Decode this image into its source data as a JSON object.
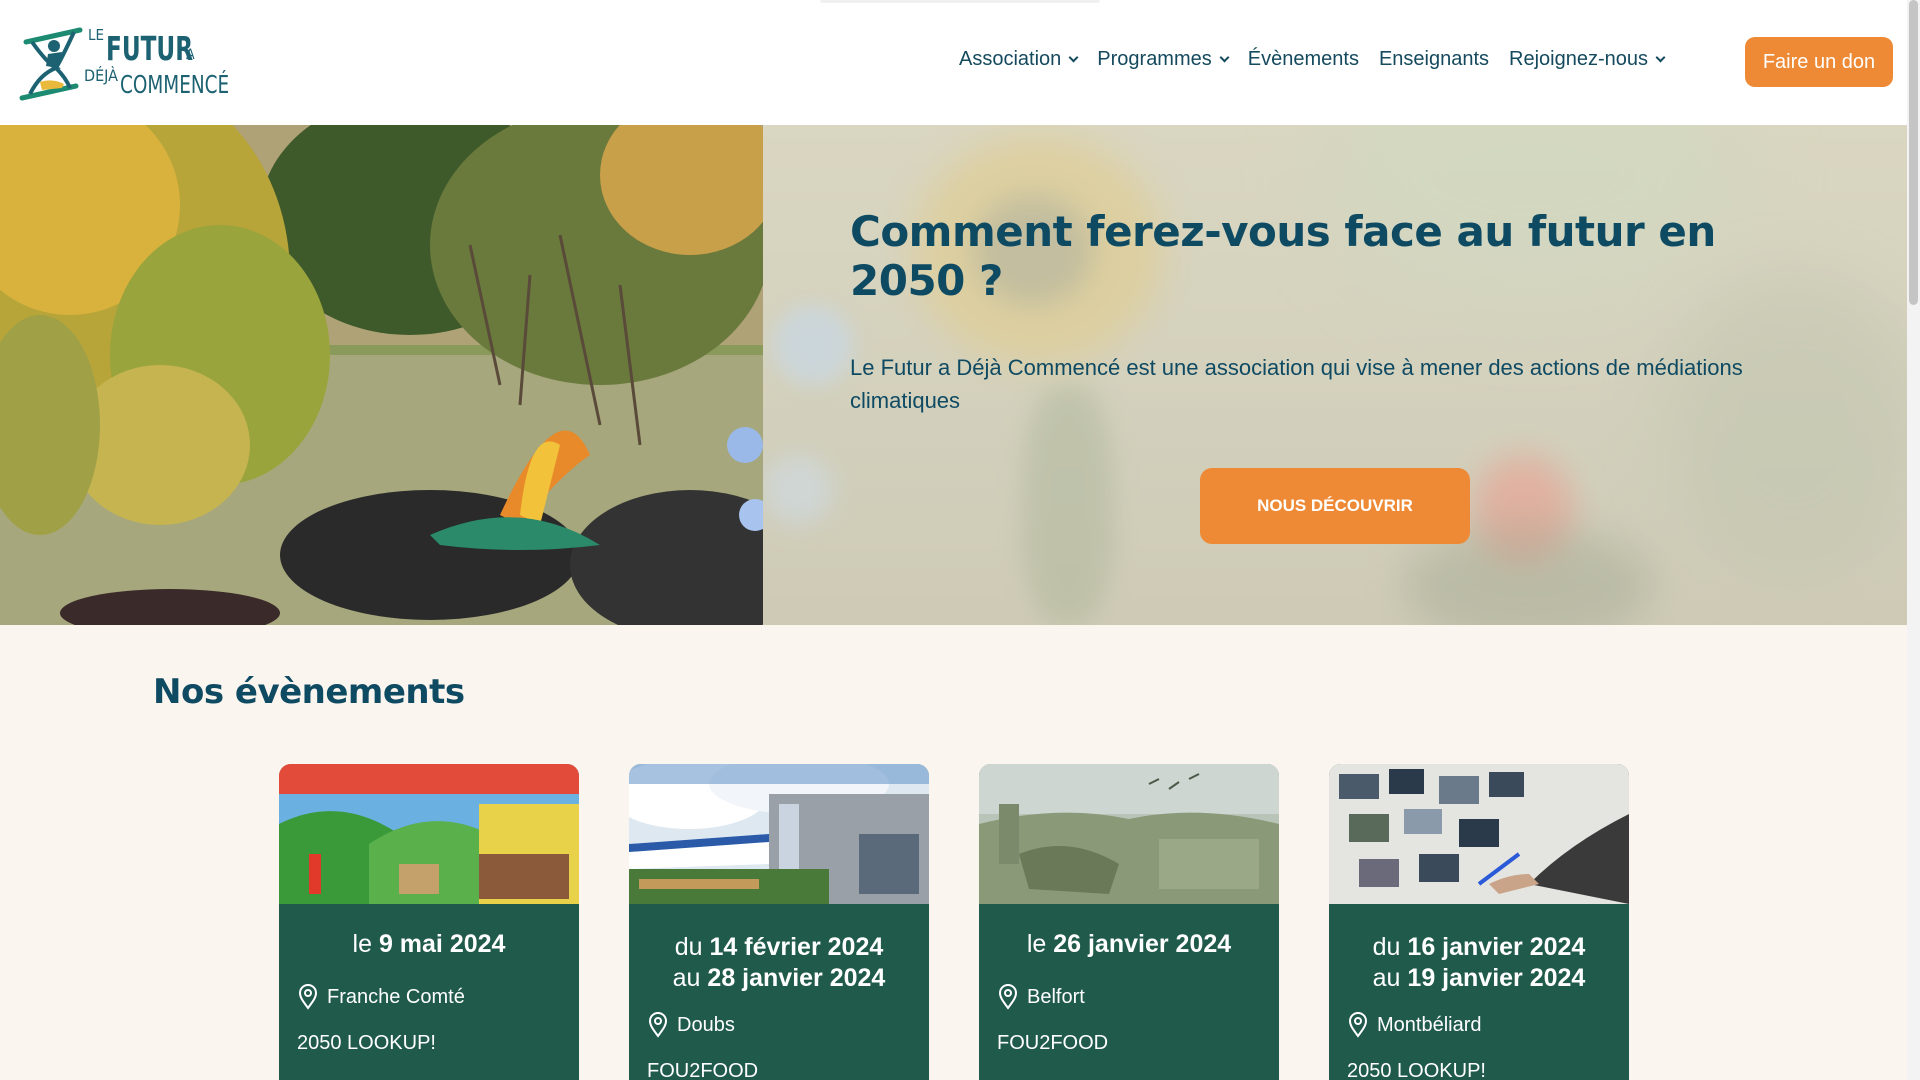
{
  "header": {
    "logo": {
      "le": "LE",
      "futur": "FUTUR",
      "a": "A",
      "deja": "DÉJÀ",
      "commence": "COMMENCÉ"
    },
    "nav": [
      {
        "label": "Association",
        "has_dropdown": true
      },
      {
        "label": "Programmes",
        "has_dropdown": true
      },
      {
        "label": "Évènements",
        "has_dropdown": false
      },
      {
        "label": "Enseignants",
        "has_dropdown": false
      },
      {
        "label": "Rejoignez-nous",
        "has_dropdown": true
      }
    ],
    "donate_label": "Faire un don"
  },
  "hero": {
    "title": "Comment ferez-vous face au futur en 2050 ?",
    "description": "Le Futur a Déjà Commencé est une association qui vise à mener des actions de médiations climatiques",
    "cta_label": "NOUS DÉCOUVRIR"
  },
  "events": {
    "title": "Nos évènements",
    "cards": [
      {
        "prefix": "le ",
        "date": "9 mai 2024",
        "location": "Franche Comté",
        "program": "2050 LOOKUP!"
      },
      {
        "prefix": "du ",
        "date": "14 février 2024",
        "prefix2": "au ",
        "date2": "28 janvier 2024",
        "location": "Doubs",
        "program": "FOU2FOOD"
      },
      {
        "prefix": "le ",
        "date": "26 janvier 2024",
        "location": "Belfort",
        "program": "FOU2FOOD"
      },
      {
        "prefix": "du ",
        "date": "16 janvier 2024",
        "prefix2": "au ",
        "date2": "19 janvier 2024",
        "location": "Montbéliard",
        "program": "2050 LOOKUP!"
      }
    ]
  },
  "colors": {
    "brand_teal": "#0f4a63",
    "accent_orange": "#ee8a35",
    "card_green": "#1f5a4a",
    "page_background": "#faf5ef"
  },
  "icons": [
    "chevron-down-icon",
    "location-pin-icon",
    "logo-hourglass-icon"
  ]
}
